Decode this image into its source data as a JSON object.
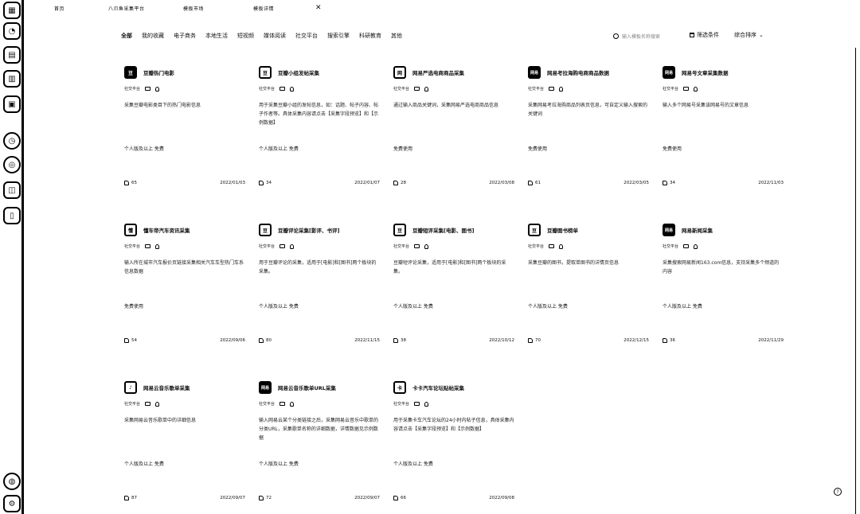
{
  "tabs": [
    {
      "label": "首页"
    },
    {
      "label": "八爪鱼采集平台"
    },
    {
      "label": "模板市场"
    },
    {
      "label": "模板详情"
    }
  ],
  "categories": [
    "全部",
    "我的收藏",
    "电子商务",
    "本地生活",
    "短视频",
    "媒体阅读",
    "社交平台",
    "搜索引擎",
    "科研教育",
    "其他"
  ],
  "search": {
    "placeholder": "输入模板名称搜索"
  },
  "filter_label": "筛选条件",
  "sort_label": "综合排序",
  "cards": [
    {
      "logo": "豆",
      "logo_style": "dark",
      "title": "豆瓣热门电影",
      "tag": "社交平台",
      "desc": "采集豆瓣电影类目下的热门电影信息",
      "price": "个人版及以上 免费",
      "likes": "65",
      "date": "2022/01/03"
    },
    {
      "logo": "豆",
      "logo_style": "light",
      "title": "豆瓣小组发帖采集",
      "tag": "社交平台",
      "desc": "用于采集豆瓣小组的发帖信息，如：话题、帖子内容、帖子作者等。具体采集内容请点击【采集字段预览】和【示例数据】",
      "price": "个人版及以上 免费",
      "likes": "34",
      "date": "2022/01/07"
    },
    {
      "logo": "网",
      "logo_style": "light",
      "title": "网易严选电商商品采集",
      "tag": "社交平台",
      "desc": "通过输入商品关键词，采集网易严选电商商品信息",
      "price": "免费使用",
      "likes": "28",
      "date": "2022/03/08"
    },
    {
      "logo": "网易",
      "logo_style": "dark",
      "title": "网易考拉海购电商商品数据",
      "tag": "社交平台",
      "desc": "采集网易考拉海购商品列表页信息，可自定义输入搜索的关键词",
      "price": "免费使用",
      "likes": "61",
      "date": "2022/03/05"
    },
    {
      "logo": "网易",
      "logo_style": "dark",
      "title": "网易号文章采集数据",
      "tag": "社交平台",
      "desc": "输入多个网易号采集该网易号的文章信息",
      "price": "免费使用",
      "likes": "34",
      "date": "2022/11/03"
    },
    {
      "logo": "懂",
      "logo_style": "light",
      "title": "懂车帝汽车资讯采集",
      "tag": "社交平台",
      "desc": "输入所在城市汽车报价页链接采集相关汽车车型热门车系信息数据",
      "price": "免费使用",
      "likes": "54",
      "date": "2022/09/06"
    },
    {
      "logo": "豆",
      "logo_style": "light",
      "title": "豆瓣评论采集[影评、书评]",
      "tag": "社交平台",
      "desc": "用于豆瓣评论的采集，适用于[电影]和[图书]两个板块的采集。",
      "price": "个人版及以上 免费",
      "likes": "80",
      "date": "2022/11/15"
    },
    {
      "logo": "豆",
      "logo_style": "light",
      "title": "豆瓣短评采集[电影、图书]",
      "tag": "社交平台",
      "desc": "豆瓣短评论采集，适用于[电影]和[图书]两个板块的采集。",
      "price": "个人版及以上 免费",
      "likes": "38",
      "date": "2022/10/12"
    },
    {
      "logo": "豆",
      "logo_style": "light",
      "title": "豆瓣图书榜单",
      "tag": "社交平台",
      "desc": "采集豆瓣的图书，提取单图书的详情页信息",
      "price": "个人版及以上 免费",
      "likes": "70",
      "date": "2022/12/15"
    },
    {
      "logo": "网易",
      "logo_style": "dark",
      "title": "网易新闻采集",
      "tag": "社交平台",
      "desc": "采集搜索网易新闻163.com信息，支持采集多个频道的内容",
      "price": "个人版及以上 免费",
      "likes": "36",
      "date": "2022/11/29"
    },
    {
      "logo": "♪",
      "logo_style": "light",
      "title": "网易云音乐歌单采集",
      "tag": "社交平台",
      "desc": "采集网易云音乐歌单中的详细信息",
      "price": "个人版及以上 免费",
      "likes": "87",
      "date": "2022/09/07"
    },
    {
      "logo": "网易",
      "logo_style": "dark",
      "title": "网易云音乐歌单URL采集",
      "tag": "社交平台",
      "desc": "输入网易云某个分类链接之后，采集网易云音乐中歌单的分类URL，采集歌单名称的详细数据，详情数据见示例数据",
      "price": "个人版及以上 免费",
      "likes": "72",
      "date": "2022/09/07"
    },
    {
      "logo": "卡",
      "logo_style": "light",
      "title": "卡卡汽车论坛贴帖采集",
      "tag": "社交平台",
      "desc": "用于采集卡车汽车论坛的24小时内帖子信息，具体采集内容请点击【采集字段预览】和【示例数据】",
      "price": "个人版及以上 免费",
      "likes": "66",
      "date": "2022/09/08"
    }
  ],
  "help_label": "?"
}
